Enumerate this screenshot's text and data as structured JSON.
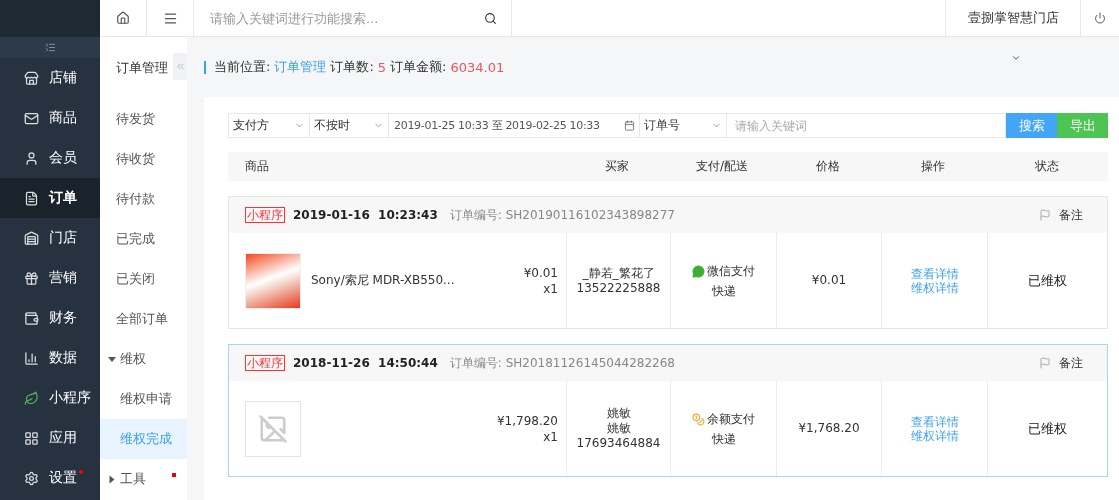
{
  "main_nav": [
    {
      "label": "店铺",
      "selected": false,
      "has_dot": false
    },
    {
      "label": "商品",
      "selected": false,
      "has_dot": false
    },
    {
      "label": "会员",
      "selected": false,
      "has_dot": false
    },
    {
      "label": "订单",
      "selected": true,
      "has_dot": false
    },
    {
      "label": "门店",
      "selected": false,
      "has_dot": false
    },
    {
      "label": "营销",
      "selected": false,
      "has_dot": false
    },
    {
      "label": "财务",
      "selected": false,
      "has_dot": false
    },
    {
      "label": "数据",
      "selected": false,
      "has_dot": false
    },
    {
      "label": "小程序",
      "selected": false,
      "has_dot": false
    },
    {
      "label": "应用",
      "selected": false,
      "has_dot": false
    },
    {
      "label": "设置",
      "selected": false,
      "has_dot": true
    }
  ],
  "top_bar": {
    "search_placeholder": "请输入关键词进行功能搜索...",
    "store_name": "壹捌掌智慧门店"
  },
  "sub_nav": {
    "title": "订单管理",
    "items": [
      {
        "kind": "link",
        "label": "待发货",
        "selected": false
      },
      {
        "kind": "link",
        "label": "待收货",
        "selected": false
      },
      {
        "kind": "link",
        "label": "待付款",
        "selected": false
      },
      {
        "kind": "link",
        "label": "已完成",
        "selected": false
      },
      {
        "kind": "link",
        "label": "已关闭",
        "selected": false
      },
      {
        "kind": "link",
        "label": "全部订单",
        "selected": false
      },
      {
        "kind": "group",
        "label": "维权",
        "expanded": true,
        "children": [
          {
            "label": "维权申请",
            "selected": false
          },
          {
            "label": "维权完成",
            "selected": true
          }
        ]
      },
      {
        "kind": "group",
        "label": "工具",
        "expanded": false,
        "has_dot": true
      }
    ]
  },
  "breadcrumb": {
    "label": "当前位置:",
    "current": "订单管理",
    "count_label": "订单数:",
    "count": "5",
    "amount_label": "订单金额:",
    "amount": "6034.01"
  },
  "filters": {
    "payment": "支付方",
    "time": "不按时",
    "date_range": "2019-01-25 10:33 至 2019-02-25 10:33",
    "field": "订单号",
    "keyword_placeholder": "请输入关键词",
    "search_button": "搜索",
    "export_button": "导出"
  },
  "columns": [
    "商品",
    "买家",
    "支付/配送",
    "价格",
    "操作",
    "状态"
  ],
  "orders": [
    {
      "highlighted": false,
      "source": "小程序",
      "date": "2019-01-16",
      "time": "10:23:43",
      "order_no": "订单编号: SH20190116102343898277",
      "note": "备注",
      "product": {
        "kind": "photo",
        "name": "Sony/索尼 MDR-XB550...",
        "price": "¥0.01",
        "qty": "x1"
      },
      "buyer": {
        "name": "_静若_繁花了",
        "phone": "13522225888"
      },
      "payment": {
        "kind": "wechat",
        "method": "微信支付",
        "delivery": "快递"
      },
      "price": "¥0.01",
      "actions": [
        "查看详情",
        "维权详情"
      ],
      "status": "已维权"
    },
    {
      "highlighted": true,
      "source": "小程序",
      "date": "2018-11-26",
      "time": "14:50:44",
      "order_no": "订单编号: SH20181126145044282268",
      "note": "备注",
      "product": {
        "kind": "placeholder",
        "price": "¥1,798.20",
        "qty": "x1"
      },
      "buyer": {
        "name": "姚敏",
        "nickname": "姚敏",
        "phone": "17693464884"
      },
      "payment": {
        "kind": "balance",
        "method": "余额支付",
        "delivery": "快递"
      },
      "price": "¥1,768.20",
      "actions": [
        "查看详情",
        "维权详情"
      ],
      "status": "已维权"
    }
  ]
}
